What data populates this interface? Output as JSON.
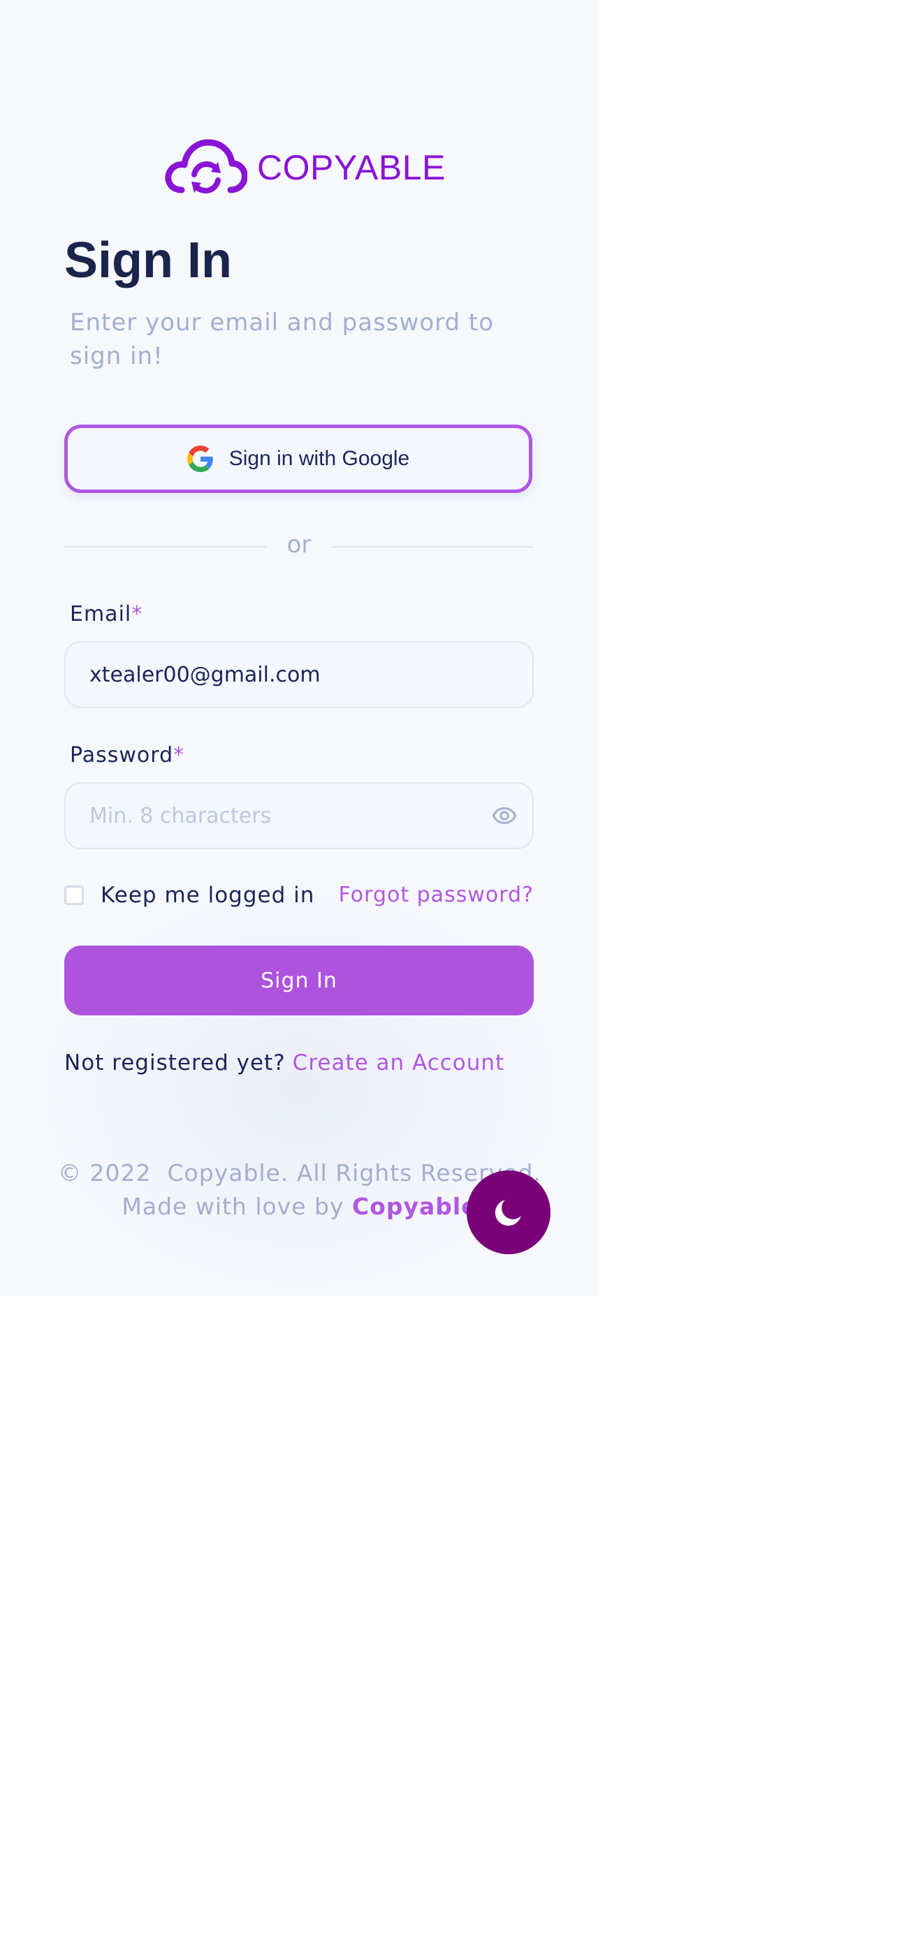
{
  "brand": {
    "name": "COPYABLE",
    "logo_icon": "cloud-sync-icon",
    "color": "#8a13d6"
  },
  "heading": {
    "title": "Sign In",
    "subtitle": "Enter your email and password to sign in!"
  },
  "google": {
    "label": "Sign in with Google",
    "icon": "google-icon"
  },
  "divider": {
    "text": "or"
  },
  "email": {
    "label": "Email",
    "required_mark": "*",
    "value": "xtealer00@gmail.com"
  },
  "password": {
    "label": "Password",
    "required_mark": "*",
    "placeholder": "Min. 8 characters",
    "toggle_icon": "eye-icon"
  },
  "remember": {
    "label": "Keep me logged in",
    "checked": false
  },
  "forgot": {
    "label": "Forgot password?"
  },
  "submit": {
    "label": "Sign In"
  },
  "register": {
    "prompt": "Not registered yet?",
    "link": "Create an Account"
  },
  "footer": {
    "copyright": "© 2022  Copyable. All Rights Reserved.",
    "made_with": "Made with love by",
    "brand": "Copyable"
  },
  "theme_toggle": {
    "icon": "moon-icon"
  },
  "colors": {
    "accent": "#b157e0",
    "accent_button": "#ad53de",
    "heading": "#1b254b",
    "muted": "#a3aed0",
    "toggle": "#790079",
    "panel_bg": "#f6f8fc"
  }
}
